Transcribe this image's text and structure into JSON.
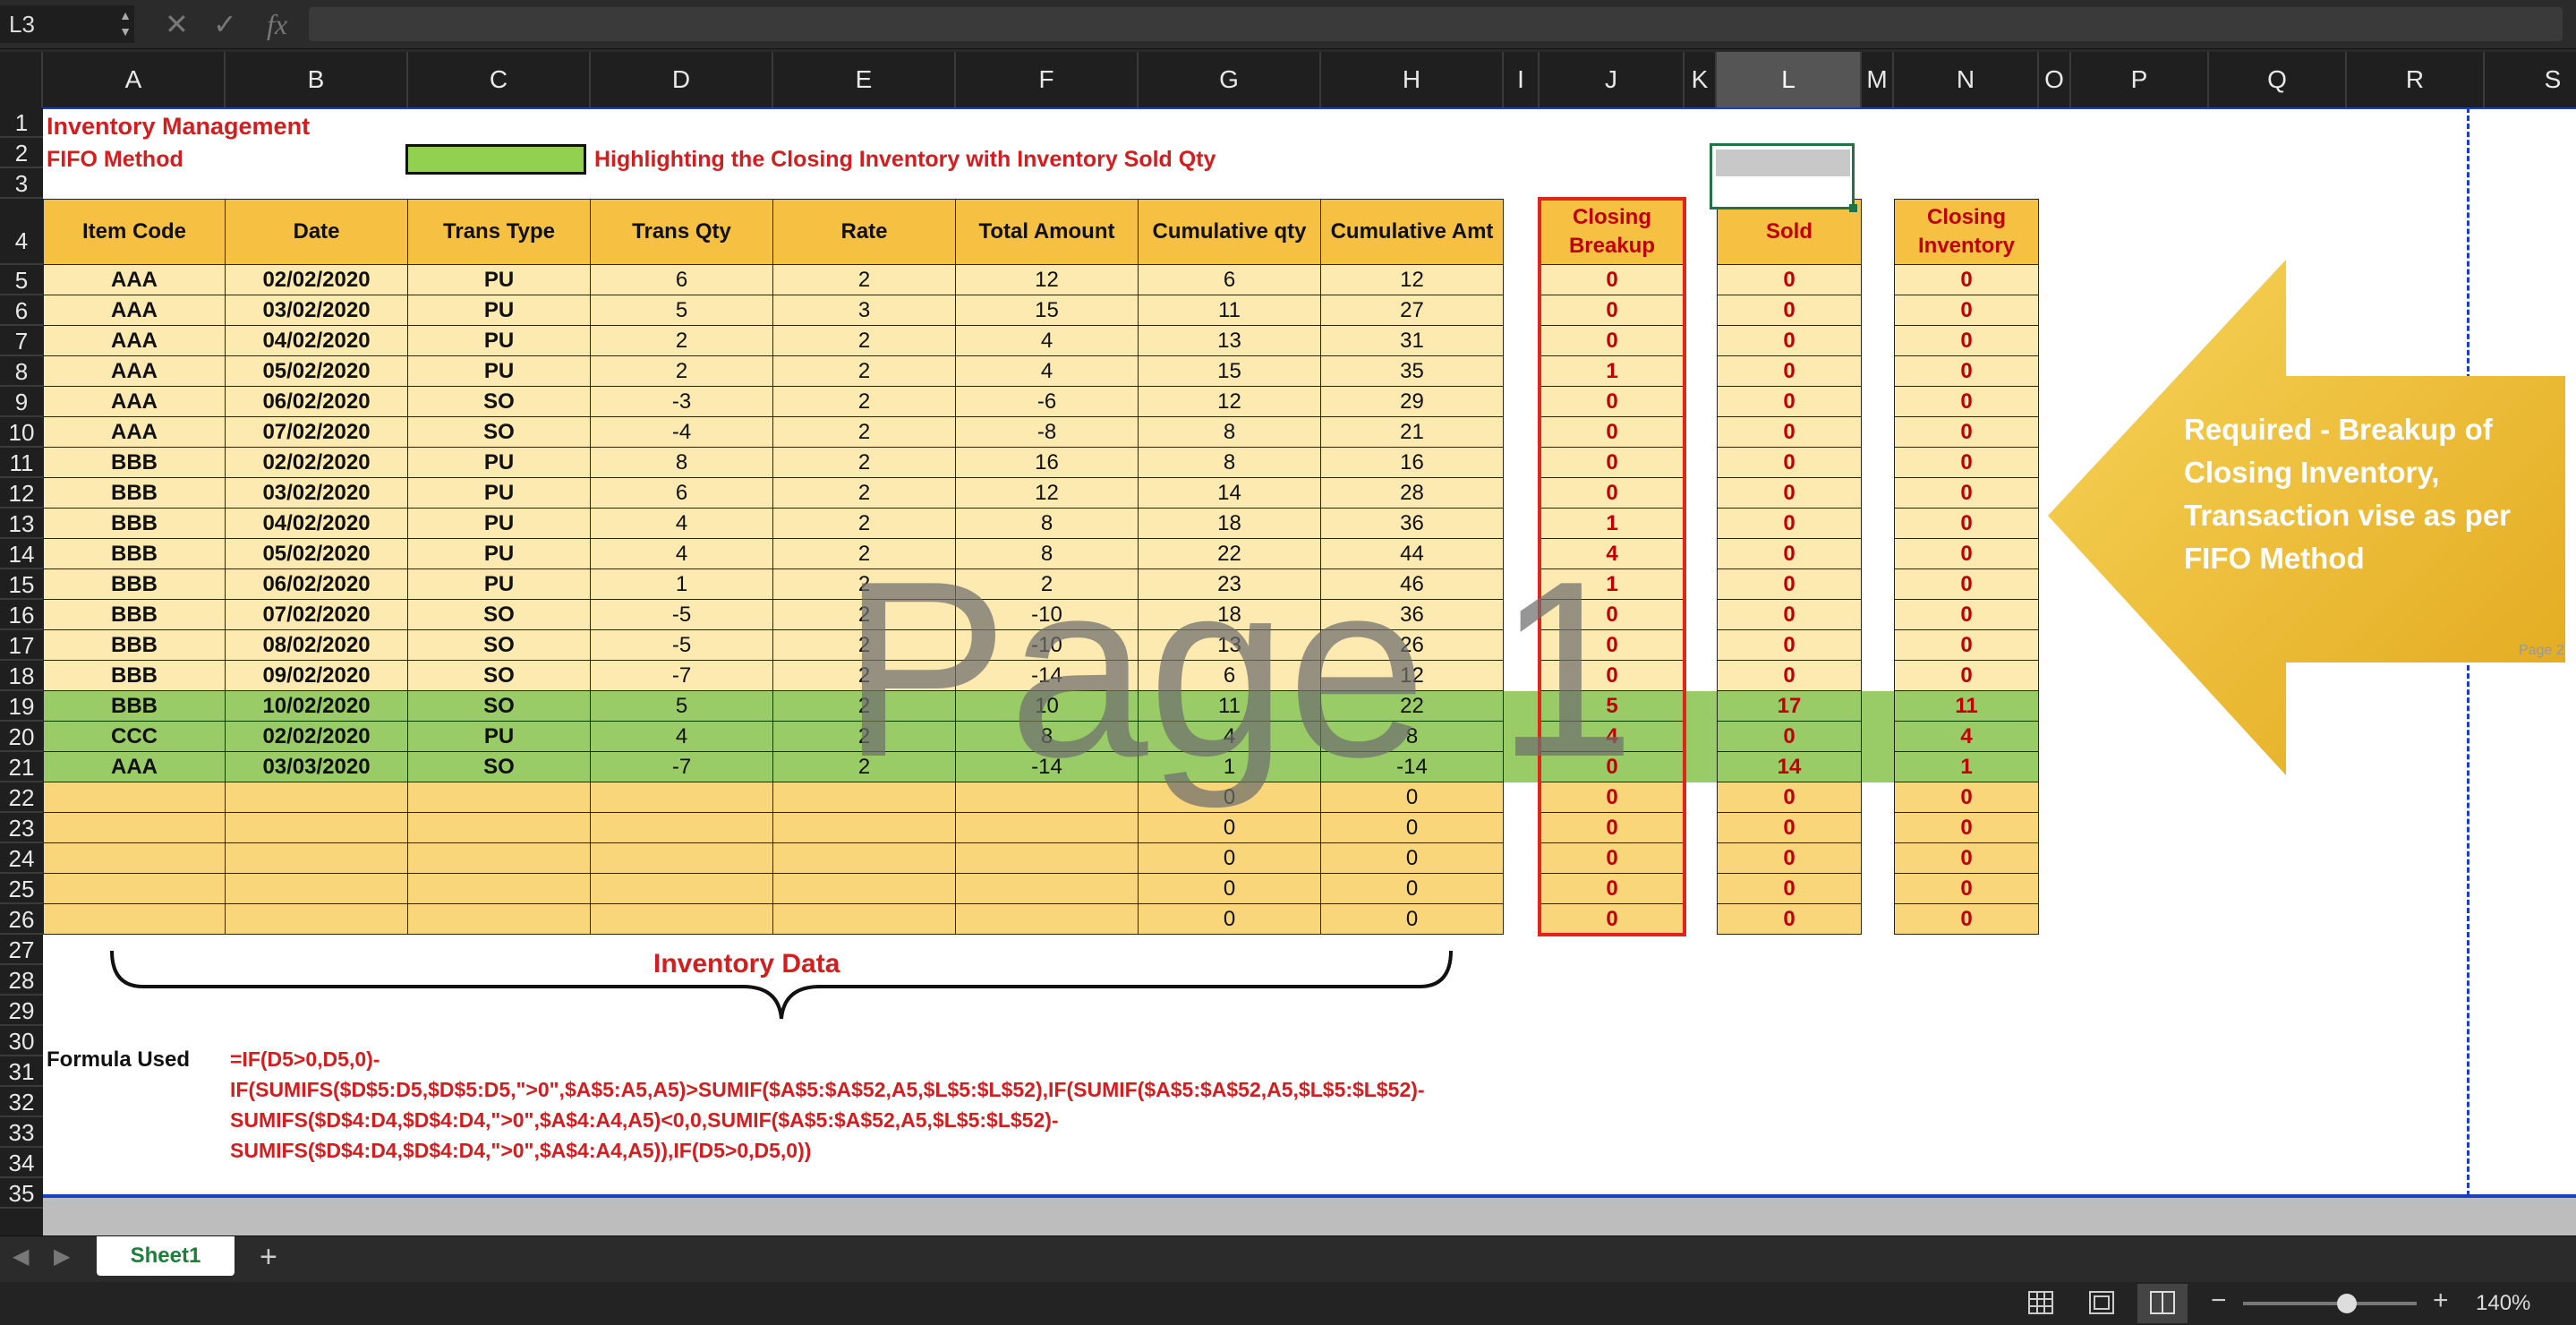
{
  "formula_bar": {
    "name_box": "L3",
    "cancel_icon": "✕",
    "enter_icon": "✓",
    "fx_label": "fx",
    "content": ""
  },
  "columns": [
    "A",
    "B",
    "C",
    "D",
    "E",
    "F",
    "G",
    "H",
    "I",
    "J",
    "K",
    "L",
    "M",
    "N",
    "O",
    "P",
    "Q",
    "R",
    "S"
  ],
  "selected_column": "L",
  "rows": [
    "1",
    "2",
    "3",
    "4",
    "5",
    "6",
    "7",
    "8",
    "9",
    "10",
    "11",
    "12",
    "13",
    "14",
    "15",
    "16",
    "17",
    "18",
    "19",
    "20",
    "21",
    "22",
    "23",
    "24",
    "25",
    "26",
    "27",
    "28",
    "29",
    "30",
    "31",
    "32",
    "33",
    "34",
    "35"
  ],
  "title": "Inventory Management",
  "subtitle": "FIFO Method",
  "legend_text": "Highlighting the Closing Inventory with Inventory Sold Qty",
  "headers": [
    "Item Code",
    "Date",
    "Trans Type",
    "Trans Qty",
    "Rate",
    "Total Amount",
    "Cumulative qty",
    "Cumulative Amt"
  ],
  "side_headers": {
    "closing_breakup": "Closing Breakup",
    "sold": "Sold",
    "closing_inventory": "Closing Inventory"
  },
  "table_rows": [
    [
      "AAA",
      "02/02/2020",
      "PU",
      "6",
      "2",
      "12",
      "6",
      "12",
      "0",
      "0",
      "0"
    ],
    [
      "AAA",
      "03/02/2020",
      "PU",
      "5",
      "3",
      "15",
      "11",
      "27",
      "0",
      "0",
      "0"
    ],
    [
      "AAA",
      "04/02/2020",
      "PU",
      "2",
      "2",
      "4",
      "13",
      "31",
      "0",
      "0",
      "0"
    ],
    [
      "AAA",
      "05/02/2020",
      "PU",
      "2",
      "2",
      "4",
      "15",
      "35",
      "1",
      "0",
      "0"
    ],
    [
      "AAA",
      "06/02/2020",
      "SO",
      "-3",
      "2",
      "-6",
      "12",
      "29",
      "0",
      "0",
      "0"
    ],
    [
      "AAA",
      "07/02/2020",
      "SO",
      "-4",
      "2",
      "-8",
      "8",
      "21",
      "0",
      "0",
      "0"
    ],
    [
      "BBB",
      "02/02/2020",
      "PU",
      "8",
      "2",
      "16",
      "8",
      "16",
      "0",
      "0",
      "0"
    ],
    [
      "BBB",
      "03/02/2020",
      "PU",
      "6",
      "2",
      "12",
      "14",
      "28",
      "0",
      "0",
      "0"
    ],
    [
      "BBB",
      "04/02/2020",
      "PU",
      "4",
      "2",
      "8",
      "18",
      "36",
      "1",
      "0",
      "0"
    ],
    [
      "BBB",
      "05/02/2020",
      "PU",
      "4",
      "2",
      "8",
      "22",
      "44",
      "4",
      "0",
      "0"
    ],
    [
      "BBB",
      "06/02/2020",
      "PU",
      "1",
      "2",
      "2",
      "23",
      "46",
      "1",
      "0",
      "0"
    ],
    [
      "BBB",
      "07/02/2020",
      "SO",
      "-5",
      "2",
      "-10",
      "18",
      "36",
      "0",
      "0",
      "0"
    ],
    [
      "BBB",
      "08/02/2020",
      "SO",
      "-5",
      "2",
      "-10",
      "13",
      "26",
      "0",
      "0",
      "0"
    ],
    [
      "BBB",
      "09/02/2020",
      "SO",
      "-7",
      "2",
      "-14",
      "6",
      "12",
      "0",
      "0",
      "0"
    ],
    [
      "BBB",
      "10/02/2020",
      "SO",
      "5",
      "2",
      "10",
      "11",
      "22",
      "5",
      "17",
      "11"
    ],
    [
      "CCC",
      "02/02/2020",
      "PU",
      "4",
      "2",
      "8",
      "4",
      "8",
      "4",
      "0",
      "4"
    ],
    [
      "AAA",
      "03/03/2020",
      "SO",
      "-7",
      "2",
      "-14",
      "1",
      "-14",
      "0",
      "14",
      "1"
    ],
    [
      "",
      "",
      "",
      "",
      "",
      "",
      "0",
      "0",
      "0",
      "0",
      "0"
    ],
    [
      "",
      "",
      "",
      "",
      "",
      "",
      "0",
      "0",
      "0",
      "0",
      "0"
    ],
    [
      "",
      "",
      "",
      "",
      "",
      "",
      "0",
      "0",
      "0",
      "0",
      "0"
    ],
    [
      "",
      "",
      "",
      "",
      "",
      "",
      "0",
      "0",
      "0",
      "0",
      "0"
    ],
    [
      "",
      "",
      "",
      "",
      "",
      "",
      "0",
      "0",
      "0",
      "0",
      "0"
    ]
  ],
  "highlight_rows": [
    14,
    15,
    16
  ],
  "colors": {
    "header_fill": "#f6c042",
    "row_fill": "#fdeab0",
    "green": "#99cc66",
    "red_text": "#d21e1e",
    "arrow": "#f2c12e"
  },
  "inventory_data_label": "Inventory Data",
  "watermark_page1": "Page 1",
  "watermark_page2": "Page 2",
  "callout_text": "Required - Breakup of Closing Inventory, Transaction vise as per FIFO Method",
  "formula_label": "Formula Used",
  "formula_lines": [
    "=IF(D5>0,D5,0)-",
    "IF(SUMIFS($D$5:D5,$D$5:D5,\">0\",$A$5:A5,A5)>SUMIF($A$5:$A$52,A5,$L$5:$L$52),IF(SUMIF($A$5:$A$52,A5,$L$5:$L$52)-",
    "SUMIFS($D$4:D4,$D$4:D4,\">0\",$A$4:A4,A5)<0,0,SUMIF($A$5:$A$52,A5,$L$5:$L$52)-",
    "SUMIFS($D$4:D4,$D$4:D4,\">0\",$A$4:A4,A5)),IF(D5>0,D5,0))"
  ],
  "sheet_tab": "Sheet1",
  "add_sheet": "+",
  "zoom": "140%",
  "zoom_level_fraction": 0.6,
  "zoom_minus": "−",
  "zoom_plus": "+"
}
